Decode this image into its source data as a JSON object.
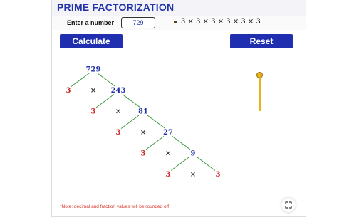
{
  "header": {
    "title": "PRIME FACTORIZATION"
  },
  "input": {
    "label": "Enter a number",
    "value": "729"
  },
  "result": {
    "text": "3 × 3 × 3 × 3 × 3 × 3"
  },
  "buttons": {
    "calculate": "Calculate",
    "reset": "Reset"
  },
  "tree": {
    "composites": [
      "729",
      "243",
      "81",
      "27",
      "9"
    ],
    "primes": [
      "3",
      "3",
      "3",
      "3",
      "3",
      "3"
    ],
    "times": "×"
  },
  "note": "*Note: decimal and fraction values will be rounded off",
  "colors": {
    "composite": "#2233aa",
    "prime": "#cc2222",
    "branch": "#3a9a3a",
    "accent": "#1f2fb0",
    "slider": "#e8b21e"
  },
  "icons": {
    "fullscreen": "fullscreen-icon"
  }
}
